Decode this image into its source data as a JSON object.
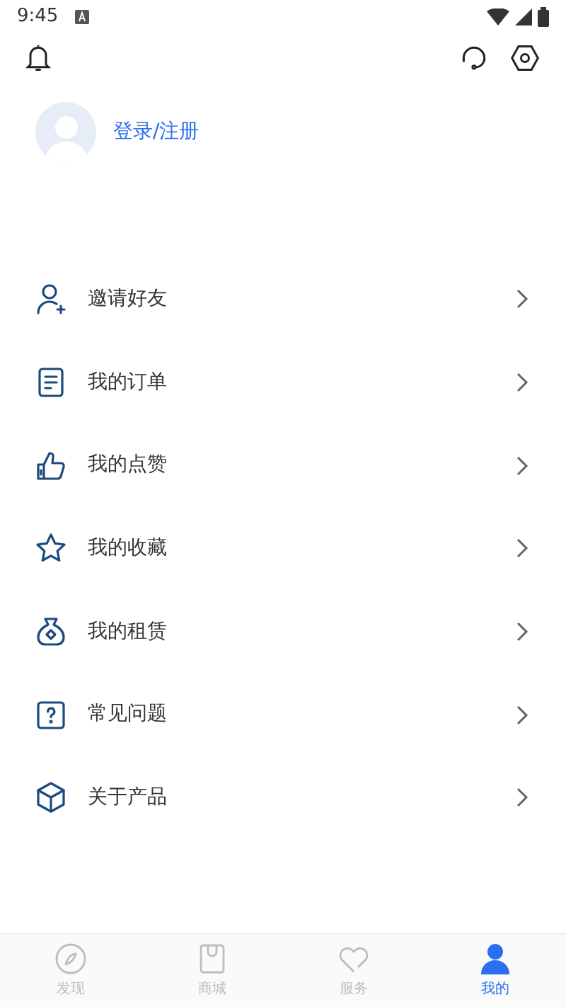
{
  "status_bar": {
    "time": "9:45"
  },
  "profile": {
    "login_link": "登录/注册"
  },
  "menu": [
    {
      "kind": "invite",
      "label": "邀请好友"
    },
    {
      "kind": "orders",
      "label": "我的订单"
    },
    {
      "kind": "likes",
      "label": "我的点赞"
    },
    {
      "kind": "favorites",
      "label": "我的收藏"
    },
    {
      "kind": "rentals",
      "label": "我的租赁"
    },
    {
      "kind": "faq",
      "label": "常见问题"
    },
    {
      "kind": "about",
      "label": "关于产品"
    }
  ],
  "tabs": [
    {
      "kind": "discover",
      "label": "发现",
      "selected": false
    },
    {
      "kind": "mall",
      "label": "商城",
      "selected": false
    },
    {
      "kind": "service",
      "label": "服务",
      "selected": false
    },
    {
      "kind": "mine",
      "label": "我的",
      "selected": true
    }
  ]
}
